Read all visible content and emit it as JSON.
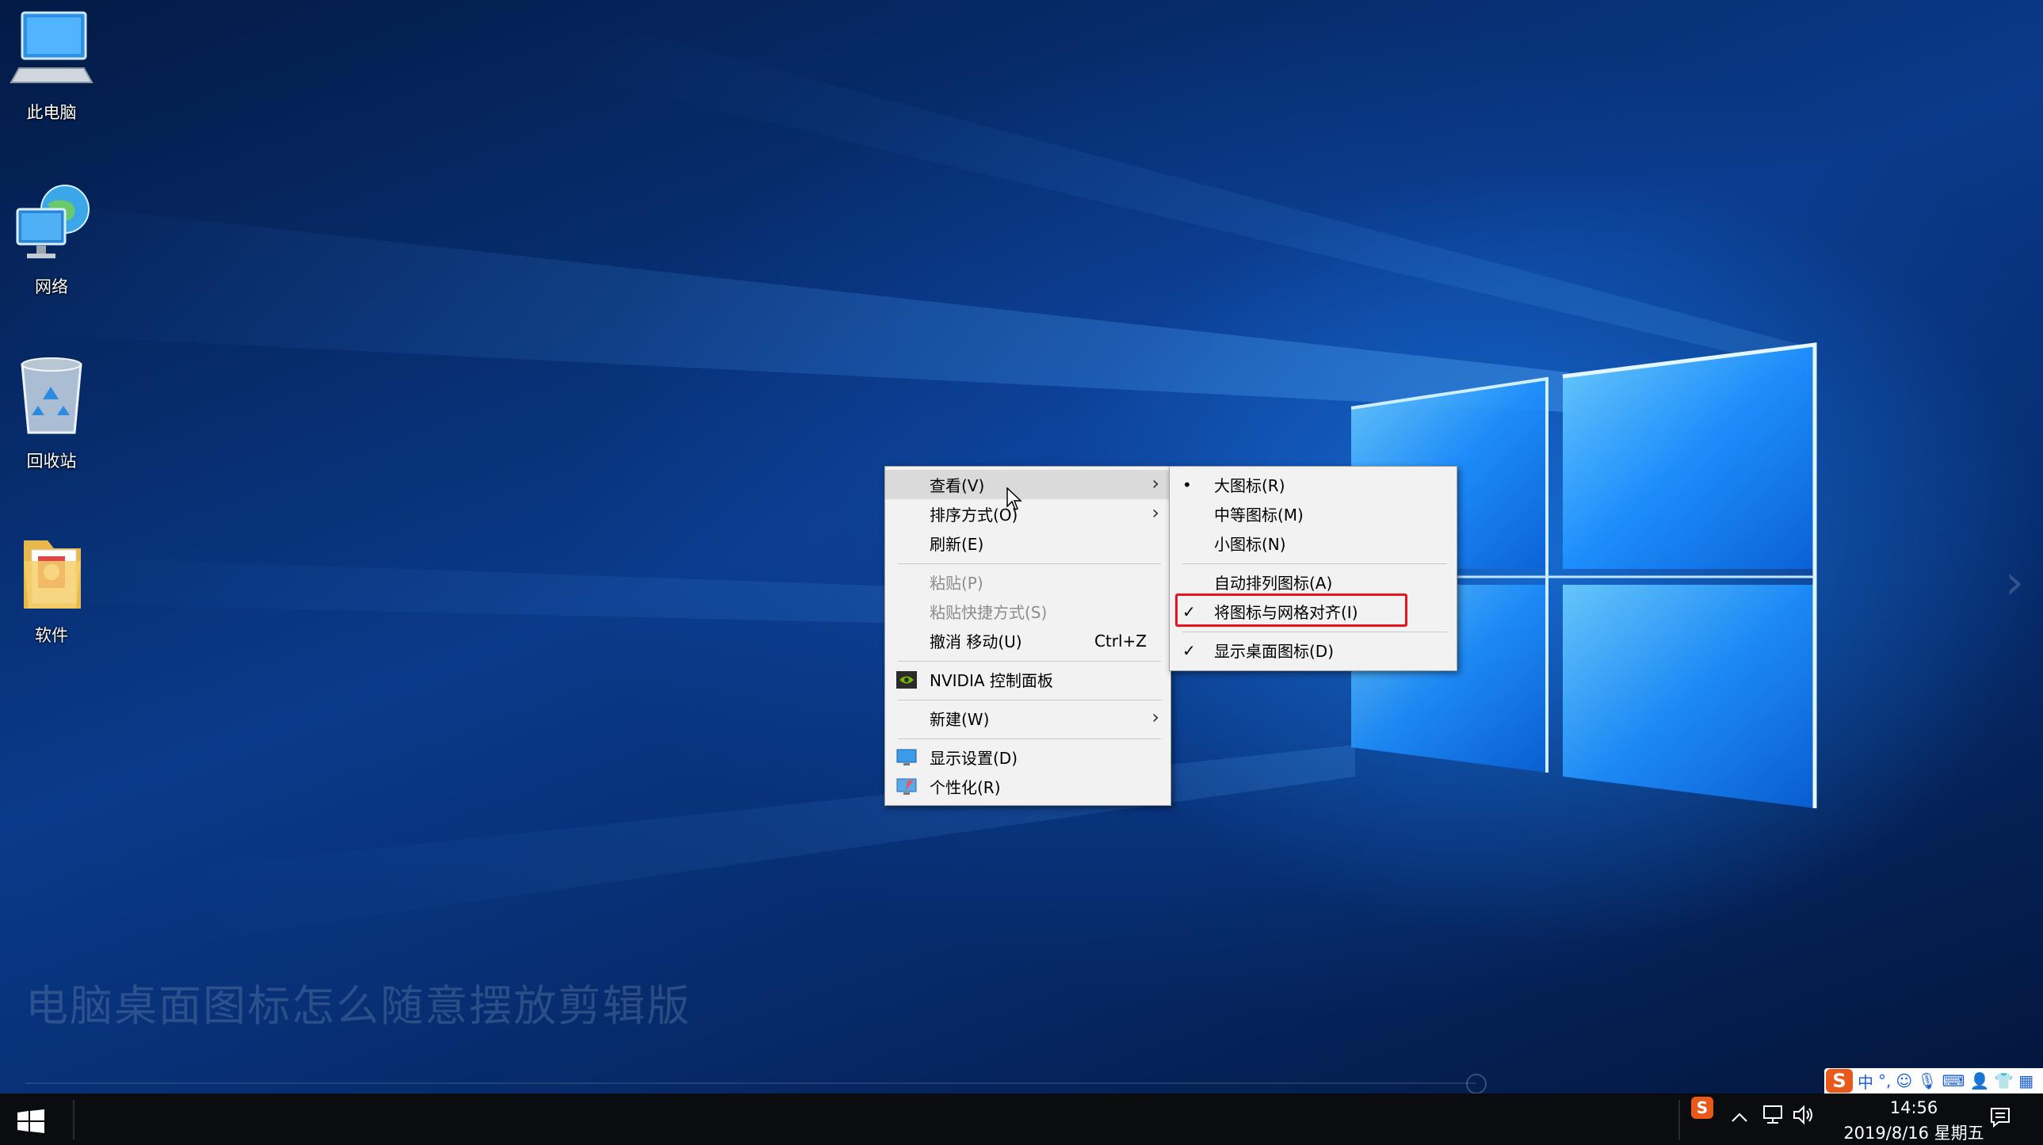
{
  "desktop": {
    "icons": [
      {
        "label": "此电脑"
      },
      {
        "label": "网络"
      },
      {
        "label": "回收站"
      },
      {
        "label": "软件"
      }
    ],
    "watermark": "电脑桌面图标怎么随意摆放剪辑版"
  },
  "context_menu": {
    "items": [
      {
        "label": "查看(V)",
        "has_submenu": true
      },
      {
        "label": "排序方式(O)",
        "has_submenu": true
      },
      {
        "label": "刷新(E)"
      },
      {
        "label": "粘贴(P)",
        "disabled": true
      },
      {
        "label": "粘贴快捷方式(S)",
        "disabled": true
      },
      {
        "label": "撤消 移动(U)",
        "shortcut": "Ctrl+Z"
      },
      {
        "label": "NVIDIA 控制面板",
        "icon": "nvidia-icon"
      },
      {
        "label": "新建(W)",
        "has_submenu": true
      },
      {
        "label": "显示设置(D)",
        "icon": "display-settings-icon"
      },
      {
        "label": "个性化(R)",
        "icon": "personalize-icon"
      }
    ]
  },
  "view_submenu": {
    "items": [
      {
        "label": "大图标(R)",
        "mark": "•"
      },
      {
        "label": "中等图标(M)"
      },
      {
        "label": "小图标(N)"
      },
      {
        "label": "自动排列图标(A)"
      },
      {
        "label": "将图标与网格对齐(I)",
        "mark": "✓",
        "highlighted": true
      },
      {
        "label": "显示桌面图标(D)",
        "mark": "✓"
      }
    ]
  },
  "ime": {
    "logo": "S",
    "mode": "中",
    "punct": "°,"
  },
  "taskbar": {
    "time": "14:56",
    "date": "2019/8/16 星期五"
  },
  "colors": {
    "highlight_box": "#e8141c",
    "menu_bg": "#f2f2f2",
    "taskbar_bg": "#0b0c10",
    "sogou_orange": "#e8591c"
  }
}
